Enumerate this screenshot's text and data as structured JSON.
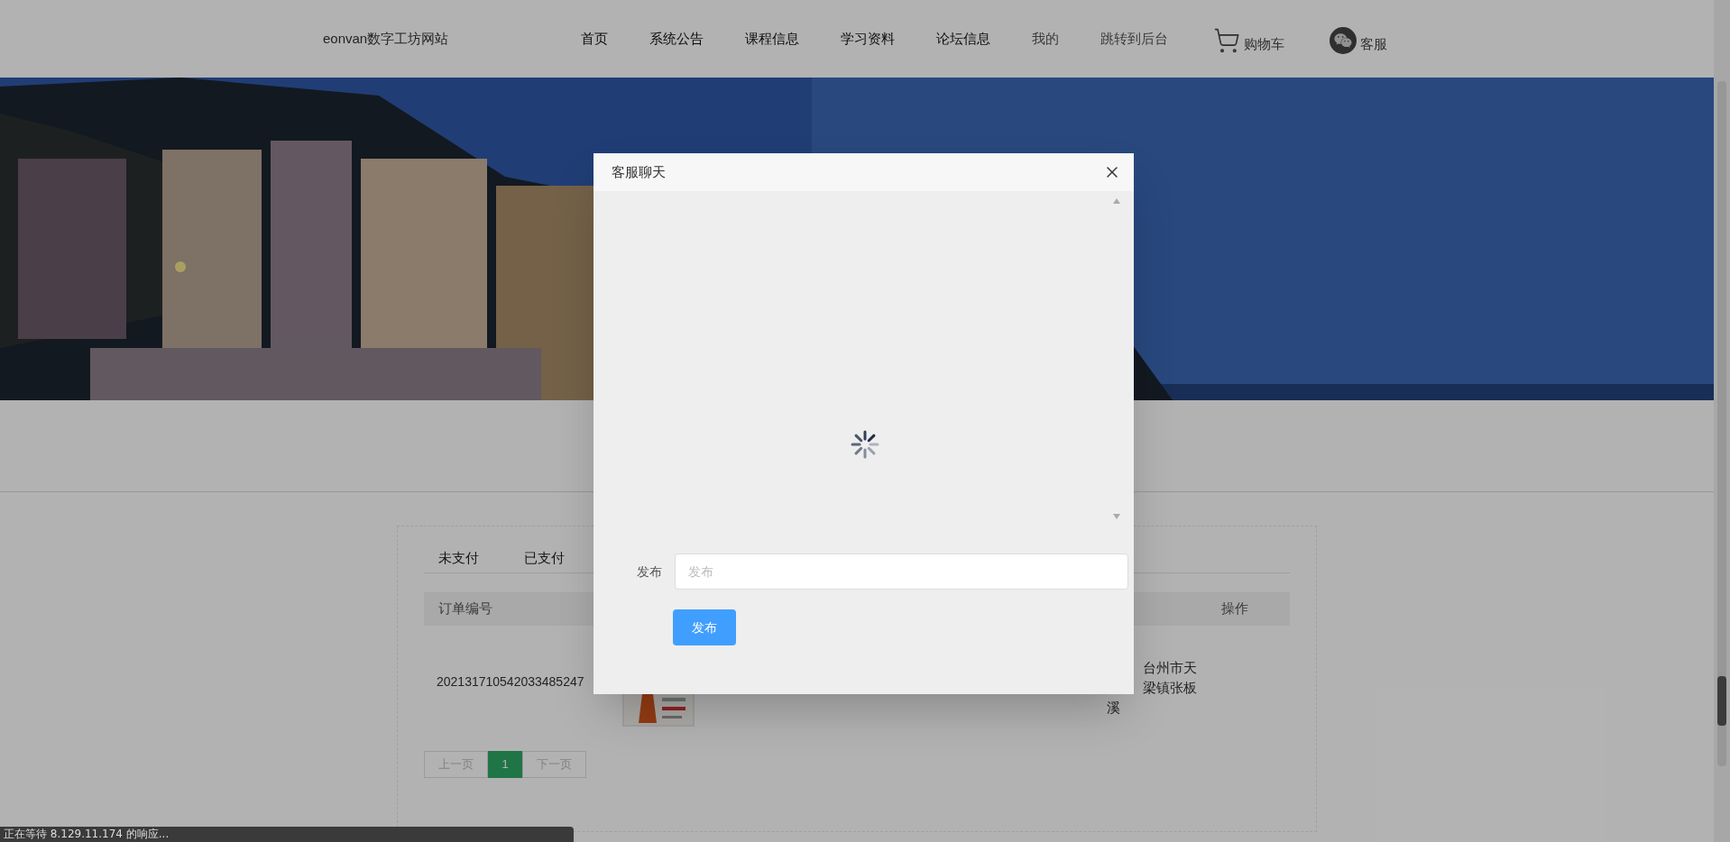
{
  "site": {
    "title": "eonvan数字工坊网站"
  },
  "nav": [
    {
      "label": "首页",
      "kind": "link"
    },
    {
      "label": "系统公告",
      "kind": "link"
    },
    {
      "label": "课程信息",
      "kind": "link"
    },
    {
      "label": "学习资料",
      "kind": "link"
    },
    {
      "label": "论坛信息",
      "kind": "link"
    },
    {
      "label": "我的",
      "kind": "plain"
    },
    {
      "label": "跳转到后台",
      "kind": "plain"
    },
    {
      "label": "购物车",
      "kind": "cart"
    },
    {
      "label": "客服",
      "kind": "chat"
    }
  ],
  "orders": {
    "tabs": [
      {
        "label": "未支付"
      },
      {
        "label": "已支付"
      }
    ],
    "columns": [
      "订单编号",
      "操作"
    ],
    "rows": [
      {
        "order_no": "202131710542033485247",
        "address_lines": [
          "台州市天",
          "梁镇张板",
          "溪"
        ]
      }
    ],
    "pagination": {
      "prev": "上一页",
      "pages": [
        {
          "label": "1",
          "selected": true
        }
      ],
      "next": "下一页"
    }
  },
  "dialog": {
    "title": "客服聊天",
    "input_label": "发布",
    "placeholder": "发布",
    "button": "发布"
  },
  "status_bar": "正在等待 8.129.11.174 的响应..."
}
